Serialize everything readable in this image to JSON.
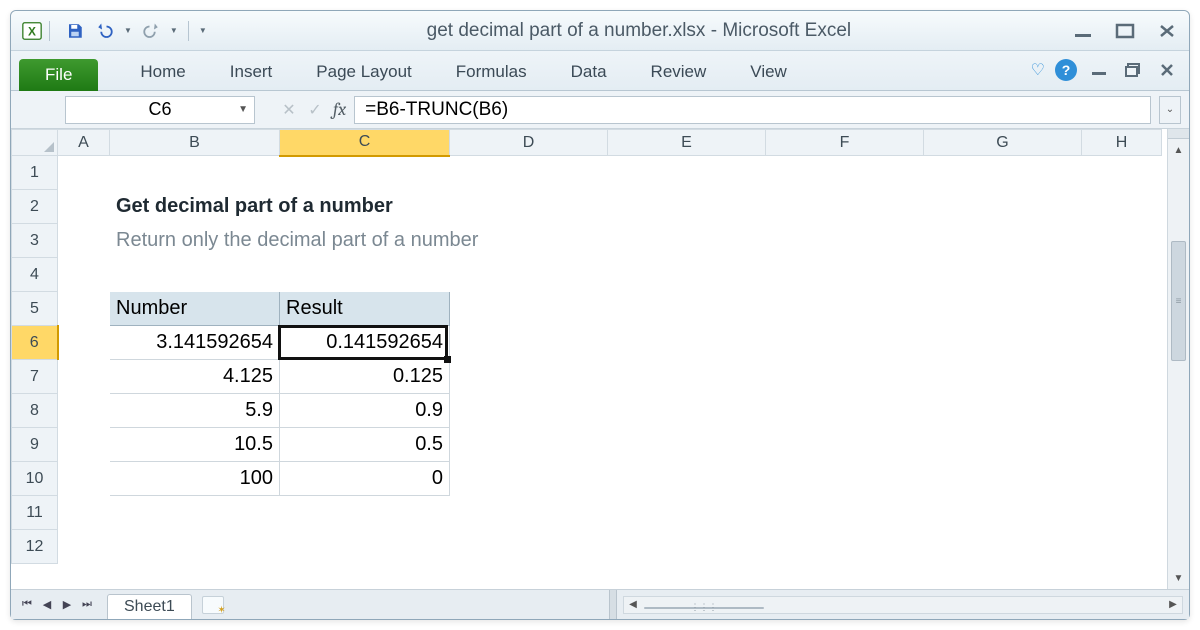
{
  "window": {
    "title": "get decimal part of a number.xlsx  -  Microsoft Excel"
  },
  "ribbon": {
    "file": "File",
    "tabs": [
      "Home",
      "Insert",
      "Page Layout",
      "Formulas",
      "Data",
      "Review",
      "View"
    ]
  },
  "formula_bar": {
    "name_box": "C6",
    "fx_label": "fx",
    "formula": "=B6-TRUNC(B6)"
  },
  "grid": {
    "columns": [
      "A",
      "B",
      "C",
      "D",
      "E",
      "F",
      "G",
      "H"
    ],
    "selected_column": "C",
    "rows": [
      1,
      2,
      3,
      4,
      5,
      6,
      7,
      8,
      9,
      10,
      11,
      12
    ],
    "selected_row": 6,
    "title": "Get decimal part of a number",
    "subtitle": "Return only the decimal part of a number",
    "headers": {
      "b": "Number",
      "c": "Result"
    },
    "data": [
      {
        "b": "3.141592654",
        "c": "0.141592654"
      },
      {
        "b": "4.125",
        "c": "0.125"
      },
      {
        "b": "5.9",
        "c": "0.9"
      },
      {
        "b": "10.5",
        "c": "0.5"
      },
      {
        "b": "100",
        "c": "0"
      }
    ]
  },
  "sheets": {
    "active": "Sheet1"
  }
}
